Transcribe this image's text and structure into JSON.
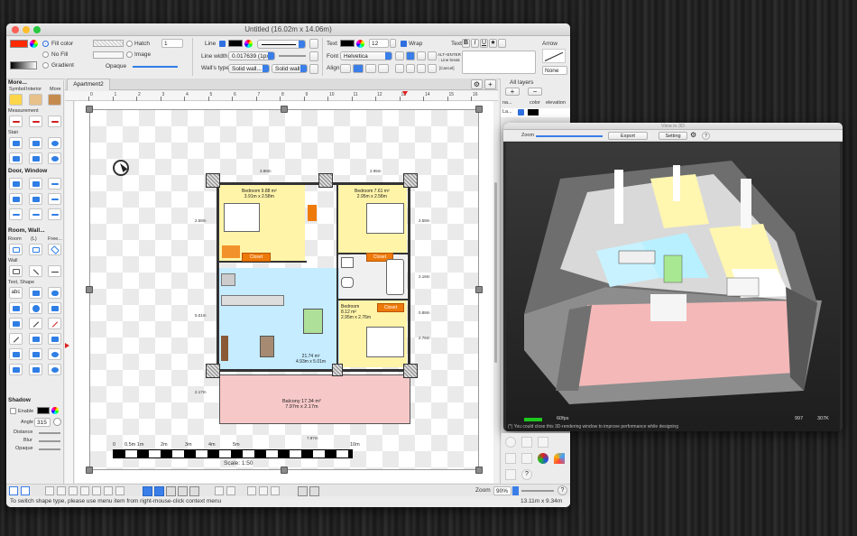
{
  "main_window": {
    "title": "Untitled (16.02m x 14.06m)",
    "fill": {
      "fill_color": "Fill color",
      "no_fill": "No Fill",
      "gradient": "Gradient",
      "hatch": "Hatch",
      "image": "Image",
      "opaque": "Opaque",
      "hatch_value": "1"
    },
    "line": {
      "line_label": "Line",
      "line_width_label": "Line width",
      "line_width_value": "0.017639 (1px)",
      "walls_type_label": "Wall's type",
      "wall_type_1": "Solid wall...",
      "wall_type_2": "Solid wall..."
    },
    "text": {
      "text_label": "Text",
      "size": "12",
      "wrap": "Wrap",
      "font_label": "Font",
      "font_value": "Helvetica",
      "align_label": "Align",
      "text_label2": "Text",
      "alt_enter": "ALT+ENTER : Line break",
      "cancel_hint": "[Cancel]"
    },
    "arrow": {
      "label": "Arrow",
      "value": "None"
    },
    "tab": "Apartment2",
    "left_panel": {
      "more": "More...",
      "tabs": [
        "Symbol",
        "Interior",
        "More"
      ],
      "measurement": "Measurement",
      "stair": "Stair",
      "door_window": "Door, Window",
      "room_wall": "Room, Wall...",
      "room": "Room",
      "l_label": "(L)",
      "free": "Free...",
      "wall": "Wall",
      "text_shape": "Text, Shape",
      "abc": "abc",
      "shadow": "Shadow",
      "enable": "Enable",
      "angle_label": "Angle",
      "angle_value": "315",
      "distance": "Distance",
      "blur": "Blur",
      "opaque": "Opaque"
    },
    "ruler_ticks": [
      "0",
      "1",
      "2",
      "3",
      "4",
      "5",
      "6",
      "7",
      "8",
      "9",
      "10",
      "11",
      "12",
      "13",
      "14",
      "15",
      "16"
    ],
    "plan": {
      "rooms": [
        {
          "name": "Bedroom 9.88 m²",
          "dims": "3.91m x 2.58m"
        },
        {
          "name": "Bedroom 7.61 m²",
          "dims": "2.95m x 2.58m"
        },
        {
          "name": "Bedroom",
          "area": "8.12 m²",
          "dims": "2.95m x 2.76m"
        },
        {
          "name": "21.74 m²",
          "dims": "4.93m x 5.01m"
        },
        {
          "name": "Balcony 17.34 m²",
          "dims": "7.97m x 2.17m"
        }
      ],
      "closet": "Closet",
      "dims_top": [
        "3.88m",
        "2.95m"
      ],
      "dims_left": [
        "2.58m",
        "5.01m",
        "2.17m"
      ],
      "dims_right": [
        "2.58m",
        "2.16m",
        "0.88m",
        "2.76m"
      ],
      "dim_bottom": "7.97m",
      "scale_ticks": [
        "0",
        "0.5m 1m",
        "2m",
        "3m",
        "4m",
        "5m",
        "10m"
      ],
      "scale": "Scale: 1:50"
    },
    "status_text": "To switch shape type, please use menu item from right-mouse-click context menu",
    "zoom_label": "Zoom",
    "zoom_value": "90%",
    "size_readout": "13.11m x 9.34m",
    "help": "?"
  },
  "layers": {
    "title": "All layers",
    "headers": [
      "na...",
      "color",
      "elevation"
    ],
    "row_name": "La..."
  },
  "view3d": {
    "title": "View in 3D",
    "zoom_label": "Zoom",
    "export": "Export",
    "setting": "Setting",
    "help": "?",
    "fps": "60fps",
    "hint": "(*) You could close this 3D-rendering window to improve performance while designing",
    "stat1": "997",
    "stat2": "307K"
  },
  "colors": {
    "accent": "#2f7ee5",
    "fill_swatch": "#ff2a00",
    "closet": "#ee7a0a",
    "room_yellow": "#fff4a8",
    "room_blue": "#c5ecff",
    "balcony": "#f7c8c8"
  }
}
